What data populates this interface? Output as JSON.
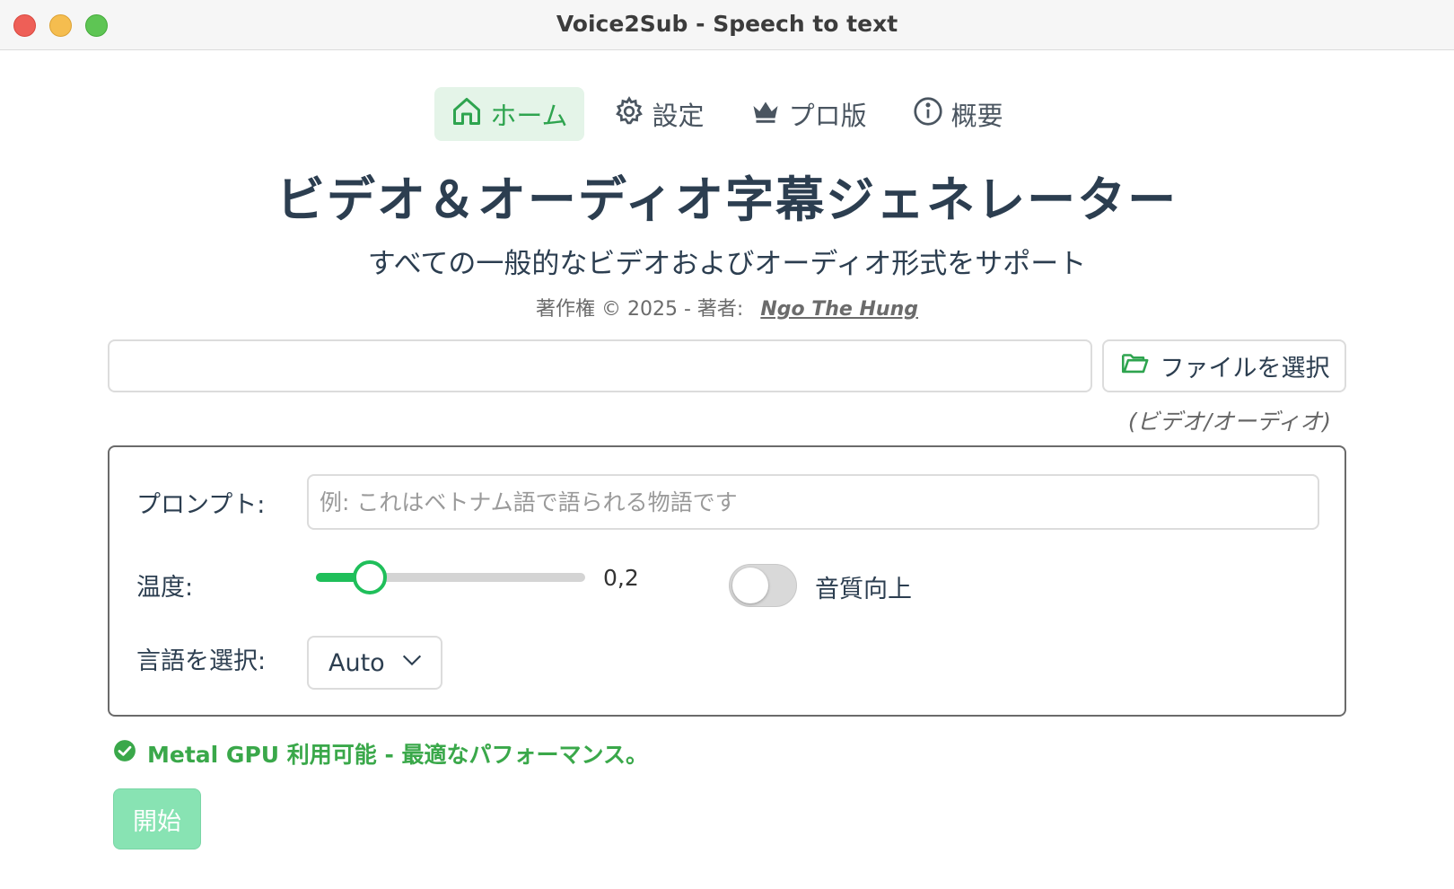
{
  "window": {
    "title": "Voice2Sub - Speech to text"
  },
  "nav": {
    "items": [
      {
        "label": "ホーム",
        "icon": "home-icon",
        "active": true
      },
      {
        "label": "設定",
        "icon": "gear-icon",
        "active": false
      },
      {
        "label": "プロ版",
        "icon": "crown-icon",
        "active": false
      },
      {
        "label": "概要",
        "icon": "info-icon",
        "active": false
      }
    ]
  },
  "header": {
    "title": "ビデオ＆オーディオ字幕ジェネレーター",
    "subtitle": "すべての一般的なビデオおよびオーディオ形式をサポート",
    "copyright": "著作権 © 2025 - 著者:",
    "author": "Ngo The Hung"
  },
  "file": {
    "value": "",
    "button_label": "ファイルを選択",
    "hint": "(ビデオ/オーディオ)"
  },
  "settings": {
    "prompt_label": "プロンプト:",
    "prompt_placeholder": "例: これはベトナム語で語られる物語です",
    "prompt_value": "",
    "temperature_label": "温度:",
    "temperature_value": "0,2",
    "temperature_fraction": 0.2,
    "enhance_label": "音質向上",
    "enhance_on": false,
    "language_label": "言語を選択:",
    "language_value": "Auto"
  },
  "status": {
    "message": "Metal GPU 利用可能 - 最適なパフォーマンス。",
    "color": "#3aa84a"
  },
  "actions": {
    "start_label": "開始"
  }
}
